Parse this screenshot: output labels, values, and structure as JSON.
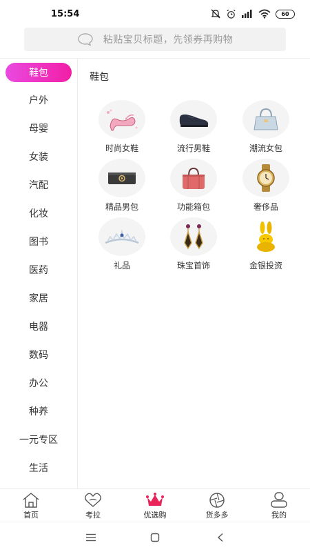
{
  "status_bar": {
    "time": "15:54",
    "battery": "60"
  },
  "search": {
    "placeholder": "粘贴宝贝标题，先领券再购物"
  },
  "sidebar": {
    "items": [
      {
        "label": "鞋包",
        "active": true
      },
      {
        "label": "户外"
      },
      {
        "label": "母婴"
      },
      {
        "label": "女装"
      },
      {
        "label": "汽配"
      },
      {
        "label": "化妆"
      },
      {
        "label": "图书"
      },
      {
        "label": "医药"
      },
      {
        "label": "家居"
      },
      {
        "label": "电器"
      },
      {
        "label": "数码"
      },
      {
        "label": "办公"
      },
      {
        "label": "种养"
      },
      {
        "label": "一元专区"
      },
      {
        "label": "生活"
      }
    ]
  },
  "content": {
    "section_title": "鞋包",
    "categories": [
      {
        "label": "时尚女鞋",
        "icon": "high-heel-icon"
      },
      {
        "label": "流行男鞋",
        "icon": "mens-shoe-icon"
      },
      {
        "label": "潮流女包",
        "icon": "handbag-icon"
      },
      {
        "label": "精品男包",
        "icon": "wallet-icon"
      },
      {
        "label": "功能箱包",
        "icon": "duffel-bag-icon"
      },
      {
        "label": "奢侈品",
        "icon": "watch-icon"
      },
      {
        "label": "礼品",
        "icon": "tiara-icon"
      },
      {
        "label": "珠宝首饰",
        "icon": "earrings-icon"
      },
      {
        "label": "金银投资",
        "icon": "gold-rabbit-icon"
      }
    ]
  },
  "tabbar": {
    "tabs": [
      {
        "label": "首页",
        "icon": "home-icon"
      },
      {
        "label": "考拉",
        "icon": "heart-icon"
      },
      {
        "label": "优选购",
        "icon": "crown-icon",
        "active": true
      },
      {
        "label": "货多多",
        "icon": "aperture-icon"
      },
      {
        "label": "我的",
        "icon": "user-icon"
      }
    ],
    "accent_color": "#e8245a"
  },
  "theme": {
    "accent_gradient": [
      "#e94ae0",
      "#f21ea5"
    ]
  }
}
